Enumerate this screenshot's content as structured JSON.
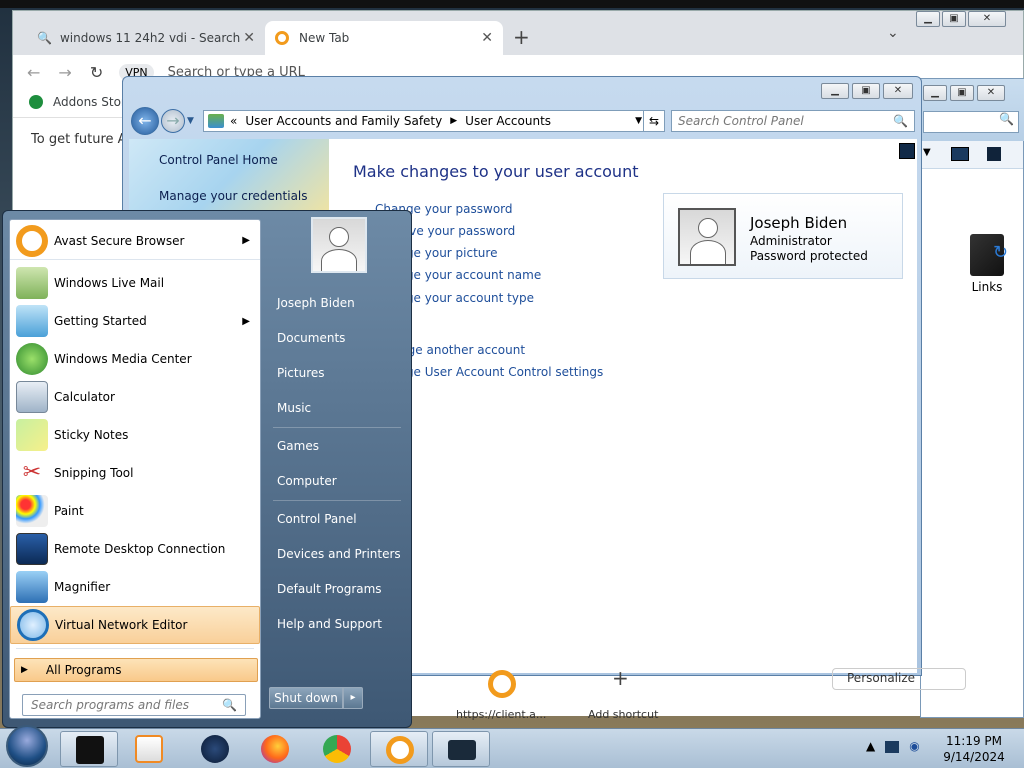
{
  "chrome": {
    "tabs": [
      {
        "label": "windows 11 24h2 vdi - Search",
        "icon": "search-icon"
      },
      {
        "label": "New Tab",
        "icon": "avast-icon"
      }
    ],
    "new_tab_symbol": "+",
    "omnibar_placeholder": "Search or type a URL",
    "vpn_label": "VPN",
    "bookmark": "Addons Store",
    "infobar_text": "To get future Ava",
    "shortcut_label_1": "https://client.a...",
    "shortcut_label_2": "Add shortcut",
    "personalize": "Personalize"
  },
  "explorer2": {
    "links_label": "Links"
  },
  "control_panel": {
    "breadcrumb": [
      "User Accounts and Family Safety",
      "User Accounts"
    ],
    "breadcrumb_prefix": "«",
    "search_placeholder": "Search Control Panel",
    "left_links": [
      "Control Panel Home",
      "Manage your credentials"
    ],
    "title": "Make changes to your user account",
    "links": [
      "Change your password",
      "Remove your password",
      "Change your picture",
      "Change your account name",
      "Change your account type",
      "Manage another account",
      "Change User Account Control settings"
    ],
    "user": {
      "name": "Joseph Biden",
      "role": "Administrator",
      "status": "Password protected"
    }
  },
  "start_menu": {
    "programs": [
      {
        "label": "Avast Secure Browser",
        "submenu": true,
        "icon": "avast-icon"
      },
      {
        "label": "Windows Live Mail",
        "submenu": false,
        "icon": "mail-icon"
      },
      {
        "label": "Getting Started",
        "submenu": true,
        "icon": "getting-started-icon"
      },
      {
        "label": "Windows Media Center",
        "submenu": false,
        "icon": "media-center-icon"
      },
      {
        "label": "Calculator",
        "submenu": false,
        "icon": "calculator-icon"
      },
      {
        "label": "Sticky Notes",
        "submenu": false,
        "icon": "sticky-notes-icon"
      },
      {
        "label": "Snipping Tool",
        "submenu": false,
        "icon": "scissors-icon"
      },
      {
        "label": "Paint",
        "submenu": false,
        "icon": "paint-icon"
      },
      {
        "label": "Remote Desktop Connection",
        "submenu": false,
        "icon": "remote-desktop-icon"
      },
      {
        "label": "Magnifier",
        "submenu": false,
        "icon": "magnifier-icon"
      },
      {
        "label": "Virtual Network Editor",
        "submenu": false,
        "icon": "globe-icon",
        "highlighted": true
      }
    ],
    "all_programs": "All Programs",
    "search_placeholder": "Search programs and files",
    "right_items": [
      "Joseph Biden",
      "Documents",
      "Pictures",
      "Music",
      "Games",
      "Computer",
      "Control Panel",
      "Devices and Printers",
      "Default Programs",
      "Help and Support"
    ],
    "shutdown_label": "Shut down",
    "shutdown_arrow": "▸"
  },
  "taskbar": {
    "time": "11:19 PM",
    "date": "9/14/2024",
    "apps": [
      "terminal-icon",
      "media-player-icon",
      "globe-icon",
      "firefox-icon",
      "chrome-icon",
      "avast-icon",
      "monitor-icon"
    ]
  },
  "colors": {
    "link": "#1e4e9a",
    "title": "#1e3287",
    "highlight": "#f9c98a"
  }
}
